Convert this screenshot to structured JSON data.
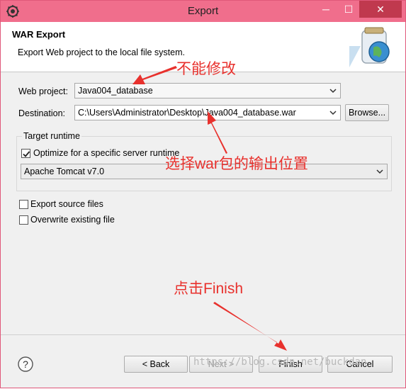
{
  "window": {
    "title": "Export",
    "controls": {
      "minimize": "─",
      "maximize": "☐",
      "close": "✕"
    }
  },
  "header": {
    "title": "WAR Export",
    "description": "Export Web project to the local file system."
  },
  "form": {
    "web_project_label": "Web project:",
    "web_project_value": "Java004_database",
    "destination_label": "Destination:",
    "destination_value": "C:\\Users\\Administrator\\Desktop\\Java004_database.war",
    "browse_label": "Browse...",
    "target_runtime": {
      "legend": "Target runtime",
      "optimize_label": "Optimize for a specific server runtime",
      "optimize_checked": true,
      "runtime_value": "Apache Tomcat v7.0"
    },
    "export_source_label": "Export source files",
    "export_source_checked": false,
    "overwrite_label": "Overwrite existing file",
    "overwrite_checked": false
  },
  "annotations": {
    "no_modify": "不能修改",
    "choose_output": "选择war包的输出位置",
    "click_finish": "点击Finish"
  },
  "footer": {
    "back_label": "< Back",
    "next_label": "Next >",
    "finish_label": "Finish",
    "cancel_label": "Cancel"
  },
  "watermark": "https://blog.csdn.net/buckdan",
  "colors": {
    "titlebar": "#f06e8c",
    "annotation": "#e8312d"
  }
}
